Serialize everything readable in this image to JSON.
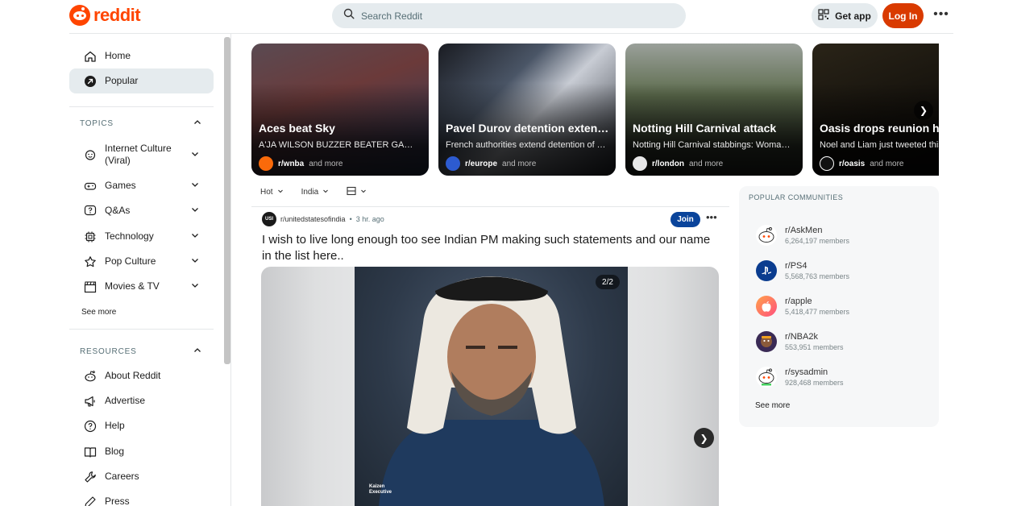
{
  "header": {
    "logo_text": "reddit",
    "search_placeholder": "Search Reddit",
    "get_app": "Get app",
    "login": "Log In",
    "more": "•••"
  },
  "sidebar": {
    "primary": [
      {
        "label": "Home",
        "icon": "home-icon"
      },
      {
        "label": "Popular",
        "icon": "popular-icon",
        "active": true
      }
    ],
    "topics_title": "TOPICS",
    "topics": [
      {
        "label": "Internet Culture (Viral)",
        "icon": "internet-culture-icon"
      },
      {
        "label": "Games",
        "icon": "gamepad-icon"
      },
      {
        "label": "Q&As",
        "icon": "question-icon"
      },
      {
        "label": "Technology",
        "icon": "chip-icon"
      },
      {
        "label": "Pop Culture",
        "icon": "star-icon"
      },
      {
        "label": "Movies & TV",
        "icon": "clapperboard-icon"
      }
    ],
    "see_more": "See more",
    "resources_title": "RESOURCES",
    "resources": [
      {
        "label": "About Reddit",
        "icon": "reddit-alien-icon"
      },
      {
        "label": "Advertise",
        "icon": "megaphone-icon"
      },
      {
        "label": "Help",
        "icon": "help-icon"
      },
      {
        "label": "Blog",
        "icon": "book-icon"
      },
      {
        "label": "Careers",
        "icon": "wrench-icon"
      },
      {
        "label": "Press",
        "icon": "pen-icon"
      }
    ]
  },
  "carousel": [
    {
      "title": "Aces beat Sky",
      "subtitle": "A'JA WILSON BUZZER BEATER GAME WINNER",
      "subreddit": "r/wnba",
      "and_more": "and more",
      "bg": "#3a2e2e",
      "avatar_color": "#fa6a0a"
    },
    {
      "title": "Pavel Durov detention extended",
      "subtitle": "French authorities extend detention of Telegram founder",
      "subreddit": "r/europe",
      "and_more": "and more",
      "bg": "#2c3440",
      "avatar_color": "#2d5bd0"
    },
    {
      "title": "Notting Hill Carnival attack",
      "subtitle": "Notting Hill Carnival stabbings: Woman named",
      "subreddit": "r/london",
      "and_more": "and more",
      "bg": "#3d4a38",
      "avatar_color": "#e8e8e8"
    },
    {
      "title": "Oasis drops reunion hint",
      "subtitle": "Noel and Liam just tweeted this",
      "subreddit": "r/oasis",
      "and_more": "and more",
      "bg": "#1e1a14",
      "avatar_color": "#111111"
    }
  ],
  "filters": [
    {
      "label": "Hot"
    },
    {
      "label": "India"
    }
  ],
  "post": {
    "avatar_text": "USI",
    "subreddit": "r/unitedstatesofindia",
    "separator": "•",
    "time": "3 hr. ago",
    "join": "Join",
    "more": "•••",
    "title": "I wish to live long enough too see Indian PM making such statements and our name in the list here..",
    "image_counter": "2/2",
    "watermark": "Kaizen Executive"
  },
  "popular_communities": {
    "title": "POPULAR COMMUNITIES",
    "items": [
      {
        "name": "r/AskMen",
        "members": "6,264,197 members",
        "icon": "askmen-avatar-icon",
        "color": "#ffffff"
      },
      {
        "name": "r/PS4",
        "members": "5,568,763 members",
        "icon": "playstation-icon",
        "color": "#0a3c8f"
      },
      {
        "name": "r/apple",
        "members": "5,418,477 members",
        "icon": "apple-icon",
        "color": "#ff6b6b"
      },
      {
        "name": "r/NBA2k",
        "members": "553,951 members",
        "icon": "nba2k-avatar-icon",
        "color": "#3a2a55"
      },
      {
        "name": "r/sysadmin",
        "members": "928,468 members",
        "icon": "sysadmin-avatar-icon",
        "color": "#ffffff"
      }
    ],
    "see_more": "See more"
  }
}
